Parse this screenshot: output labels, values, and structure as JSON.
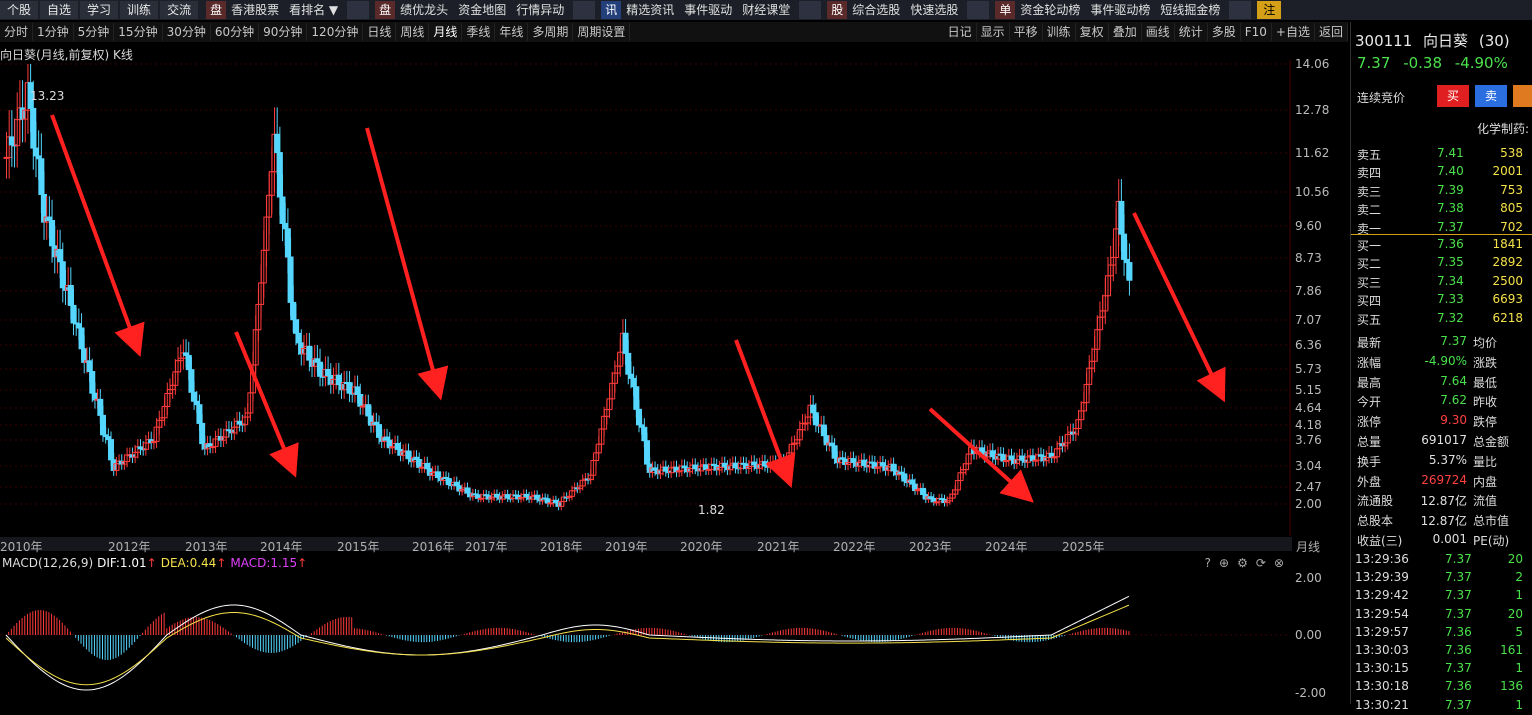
{
  "topbar": {
    "left_buttons": [
      "个股",
      "自选",
      "学习",
      "训练",
      "交流"
    ],
    "groups": [
      {
        "tag": "盘",
        "items": [
          "香港股票",
          "看排名 ▼"
        ],
        "tag_style": "red"
      },
      {
        "tag": "盘",
        "items": [
          "绩优龙头",
          "资金地图",
          "行情异动"
        ],
        "tag_style": "red"
      },
      {
        "tag": "讯",
        "items": [
          "精选资讯",
          "事件驱动",
          "财经课堂"
        ],
        "tag_style": "blue"
      },
      {
        "tag": "股",
        "items": [
          "综合选股",
          "快速选股"
        ],
        "tag_style": "red"
      },
      {
        "tag": "单",
        "items": [
          "资金轮动榜",
          "事件驱动榜",
          "短线掘金榜"
        ],
        "tag_style": "red"
      }
    ],
    "right_tag": "注"
  },
  "toolbar2": {
    "periods": [
      "分时",
      "1分钟",
      "5分钟",
      "15分钟",
      "30分钟",
      "60分钟",
      "90分钟",
      "120分钟",
      "日线",
      "周线",
      "月线",
      "季线",
      "年线",
      "多周期",
      "周期设置"
    ],
    "active": "月线",
    "tools": [
      "日记",
      "显示",
      "平移",
      "训练",
      "复权",
      "叠加",
      "画线",
      "统计",
      "多股",
      "F10",
      "+自选",
      "返回"
    ]
  },
  "chart": {
    "title": "向日葵(月线,前复权) K线",
    "y_ticks": [
      "14.06",
      "12.78",
      "11.62",
      "10.56",
      "9.60",
      "8.73",
      "7.86",
      "7.07",
      "6.36",
      "5.73",
      "5.15",
      "4.64",
      "4.18",
      "3.76",
      "3.04",
      "2.47",
      "2.00"
    ],
    "x_labels": [
      "2010年",
      "2012年",
      "2013年",
      "2014年",
      "2015年",
      "2016年",
      "2017年",
      "2018年",
      "2019年",
      "2020年",
      "2021年",
      "2022年",
      "2023年",
      "2024年",
      "2025年"
    ],
    "period_label": "月线",
    "high_label": "13.23",
    "low_label": "1.82",
    "colors": {
      "up": "#ff3b3b",
      "down": "#54d6ff",
      "arrow": "#ff2020",
      "grid": "#3a0000"
    }
  },
  "macd": {
    "title": "MACD(12,26,9)",
    "dif": "DIF:1.01",
    "dea": "DEA:0.44",
    "macd": "MACD:1.15",
    "y_ticks": [
      "2.00",
      "0.00",
      "-2.00"
    ]
  },
  "panel": {
    "code": "300111",
    "name": "向日葵",
    "count": "(30)",
    "price": "7.37",
    "change": "-0.38",
    "pct": "-4.90%",
    "auction_label": "连续竞价",
    "buy_btn": "买",
    "sell_btn": "卖",
    "industry": "化学制药:",
    "asks": [
      {
        "label": "卖五",
        "price": "7.41",
        "vol": "538"
      },
      {
        "label": "卖四",
        "price": "7.40",
        "vol": "2001"
      },
      {
        "label": "卖三",
        "price": "7.39",
        "vol": "753"
      },
      {
        "label": "卖二",
        "price": "7.38",
        "vol": "805"
      },
      {
        "label": "卖一",
        "price": "7.37",
        "vol": "702"
      }
    ],
    "bids": [
      {
        "label": "买一",
        "price": "7.36",
        "vol": "1841"
      },
      {
        "label": "买二",
        "price": "7.35",
        "vol": "2892"
      },
      {
        "label": "买三",
        "price": "7.34",
        "vol": "2500"
      },
      {
        "label": "买四",
        "price": "7.33",
        "vol": "6693"
      },
      {
        "label": "买五",
        "price": "7.32",
        "vol": "6218"
      }
    ],
    "stats": [
      {
        "label": "最新",
        "value": "7.37",
        "label2": "均价",
        "color": "#4be14b"
      },
      {
        "label": "涨幅",
        "value": "-4.90%",
        "label2": "涨跌",
        "color": "#4be14b"
      },
      {
        "label": "最高",
        "value": "7.64",
        "label2": "最低",
        "color": "#4be14b"
      },
      {
        "label": "今开",
        "value": "7.62",
        "label2": "昨收",
        "color": "#4be14b"
      },
      {
        "label": "涨停",
        "value": "9.30",
        "label2": "跌停",
        "color": "#ff4040"
      },
      {
        "label": "总量",
        "value": "691017",
        "label2": "总金额",
        "color": "#e0e0e0"
      },
      {
        "label": "换手",
        "value": "5.37%",
        "label2": "量比",
        "color": "#e0e0e0"
      },
      {
        "label": "外盘",
        "value": "269724",
        "label2": "内盘",
        "color": "#ff4040"
      },
      {
        "label": "流通股",
        "value": "12.87亿",
        "label2": "流值",
        "color": "#e0e0e0"
      },
      {
        "label": "总股本",
        "value": "12.87亿",
        "label2": "总市值",
        "color": "#e0e0e0"
      },
      {
        "label": "收益(三)",
        "value": "0.001",
        "label2": "PE(动)",
        "color": "#e0e0e0"
      }
    ],
    "ticks": [
      {
        "time": "13:29:36",
        "price": "7.37",
        "vol": "20"
      },
      {
        "time": "13:29:39",
        "price": "7.37",
        "vol": "2"
      },
      {
        "time": "13:29:42",
        "price": "7.37",
        "vol": "1"
      },
      {
        "time": "13:29:54",
        "price": "7.37",
        "vol": "20"
      },
      {
        "time": "13:29:57",
        "price": "7.36",
        "vol": "5"
      },
      {
        "time": "13:30:03",
        "price": "7.36",
        "vol": "161"
      },
      {
        "time": "13:30:15",
        "price": "7.37",
        "vol": "1"
      },
      {
        "time": "13:30:18",
        "price": "7.36",
        "vol": "136"
      },
      {
        "time": "13:30:21",
        "price": "7.37",
        "vol": "1"
      }
    ]
  }
}
